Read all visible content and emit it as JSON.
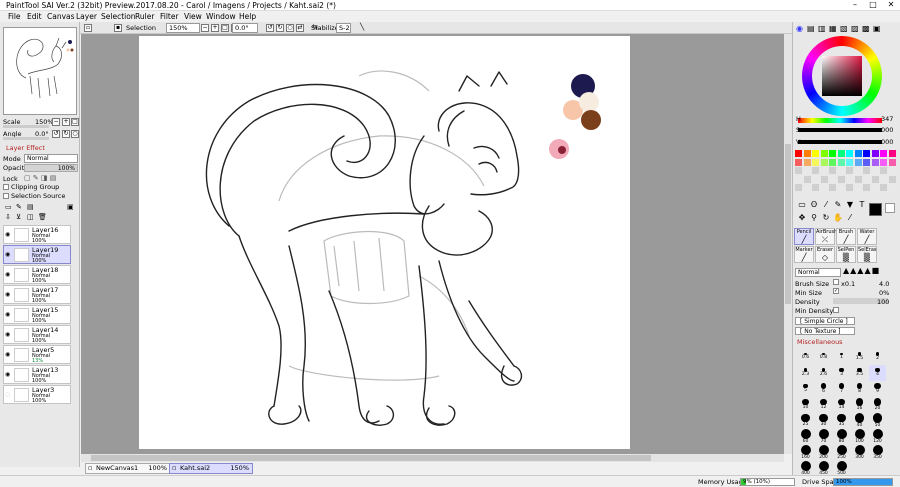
{
  "window": {
    "title": "PaintTool SAI Ver.2 (32bit) Preview.2017.08.20 - Carol / Imagens / Projects / Kaht.sai2 (*)"
  },
  "menu": [
    "File",
    "Edit",
    "Canvas",
    "Layer",
    "Selection",
    "Ruler",
    "Filter",
    "View",
    "Window",
    "Help"
  ],
  "toolbar": {
    "selection_label": "Selection",
    "zoom": "150%",
    "angle": "0.0°",
    "stabilizer_label": "Stabilizer",
    "stabilizer_value": "S-2"
  },
  "left": {
    "scale_label": "Scale",
    "scale_value": "150%",
    "angle_label": "Angle",
    "angle_value": "0.0°",
    "layer_effect": "Layer Effect",
    "mode_label": "Mode",
    "mode_value": "Normal",
    "opacity_label": "Opacity",
    "opacity_value": "100%",
    "lock_label": "Lock",
    "clipping_group": "Clipping Group",
    "selection_source": "Selection Source",
    "layers": [
      {
        "name": "Layer16",
        "mode": "Normal",
        "opacity": "100%",
        "visible": true
      },
      {
        "name": "Layer19",
        "mode": "Normal",
        "opacity": "100%",
        "visible": true,
        "selected": true
      },
      {
        "name": "Layer18",
        "mode": "Normal",
        "opacity": "100%",
        "visible": true
      },
      {
        "name": "Layer17",
        "mode": "Normal",
        "opacity": "100%",
        "visible": true
      },
      {
        "name": "Layer15",
        "mode": "Normal",
        "opacity": "100%",
        "visible": true
      },
      {
        "name": "Layer14",
        "mode": "Normal",
        "opacity": "100%",
        "visible": true
      },
      {
        "name": "Layer5",
        "mode": "Normal",
        "opacity": "13%",
        "visible": true
      },
      {
        "name": "Layer13",
        "mode": "Normal",
        "opacity": "100%",
        "visible": true
      },
      {
        "name": "Layer3",
        "mode": "Normal",
        "opacity": "100%",
        "visible": false
      }
    ]
  },
  "tabs": [
    {
      "name": "NewCanvas1",
      "zoom": "100%"
    },
    {
      "name": "Kaht.sai2",
      "zoom": "150%"
    }
  ],
  "status": {
    "memory_label": "Memory Usage",
    "memory_value": "9% (10%)",
    "memory_fraction": 0.09,
    "drive_label": "Drive Space",
    "drive_value": "100%",
    "drive_fraction": 1.0
  },
  "color": {
    "hsv": [
      {
        "label": "H",
        "value": "347"
      },
      {
        "label": "S",
        "value": "000"
      },
      {
        "label": "V",
        "value": "000"
      }
    ],
    "current": "#000000",
    "palette_swatches": [
      "#ff0000",
      "#ff8000",
      "#ffff00",
      "#80ff00",
      "#00ff00",
      "#00ff80",
      "#00ffff",
      "#0080ff",
      "#0000ff",
      "#8000ff",
      "#ff00ff",
      "#ff0080"
    ],
    "ref_colors": [
      "#1c1a4e",
      "#f7c6a8",
      "#f6ece0",
      "#7b3f1c",
      "#f2a9b8",
      "#8a2236"
    ]
  },
  "tools": {
    "brush_tools": [
      {
        "name": "Pencil",
        "selected": true
      },
      {
        "name": "AirBrush"
      },
      {
        "name": "Brush"
      },
      {
        "name": "Water"
      },
      {
        "name": "Marker"
      },
      {
        "name": "Eraser"
      },
      {
        "name": "SelPen"
      },
      {
        "name": "SelEras"
      }
    ],
    "blend_mode": "Normal",
    "brush_size_label": "Brush Size",
    "brush_size_mult": "x0.1",
    "brush_size_value": "4.0",
    "min_size_label": "Min Size",
    "min_size_value": "0%",
    "density_label": "Density",
    "density_value": "100",
    "min_density_label": "Min Density",
    "shape": "[ Simple Circle ]",
    "texture": "[ No Texture ]",
    "misc_label": "Miscellaneous",
    "brush_sizes": [
      "0.6",
      "0.8",
      "1",
      "1.5",
      "2",
      "2.3",
      "2.6",
      "3",
      "3.5",
      "4",
      "5",
      "6",
      "7",
      "8",
      "9",
      "10",
      "12",
      "14",
      "16",
      "20",
      "25",
      "30",
      "35",
      "40",
      "50",
      "60",
      "70",
      "80",
      "100",
      "120",
      "160",
      "200",
      "250",
      "300",
      "350",
      "400",
      "450",
      "500"
    ]
  }
}
